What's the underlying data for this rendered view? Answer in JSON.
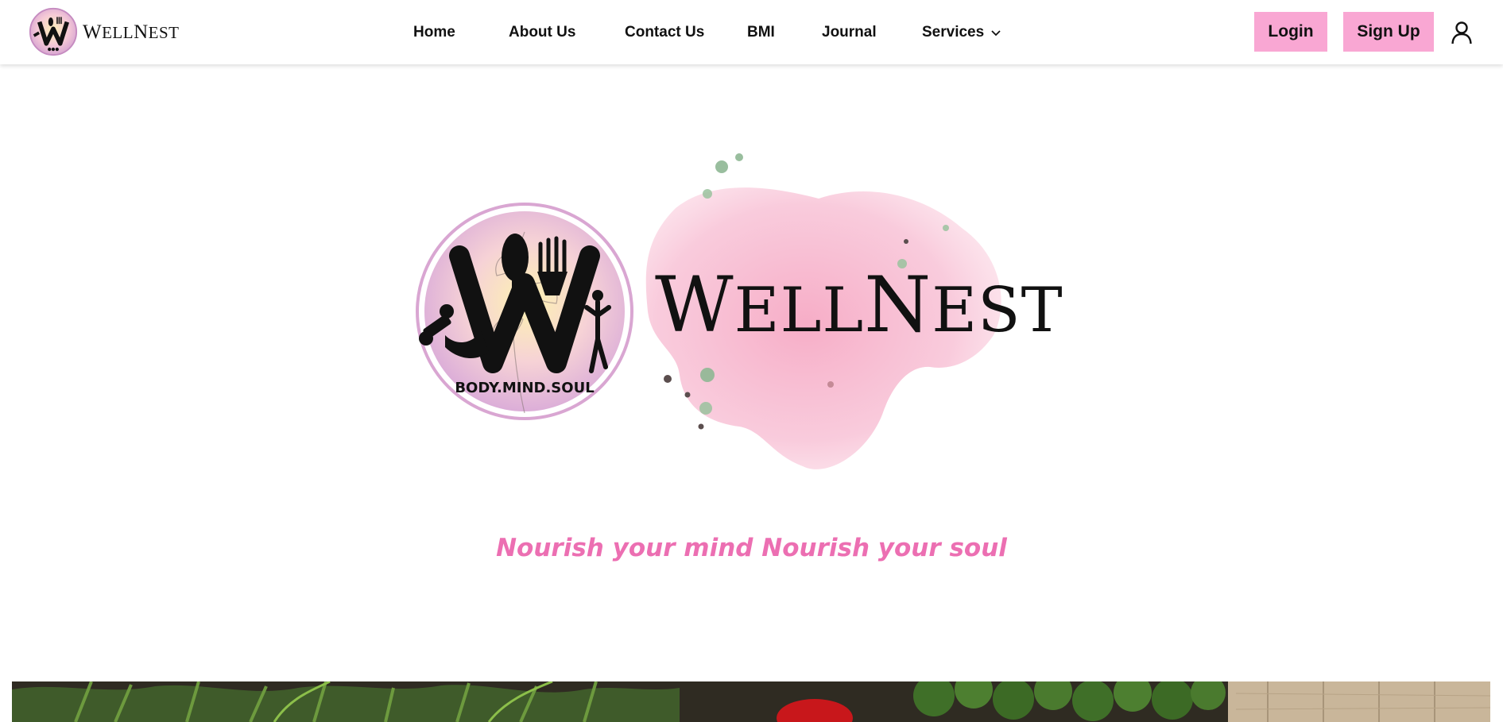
{
  "brand": {
    "name_first": "W",
    "name_rest_1": "ELL",
    "name_mid": "N",
    "name_rest_2": "EST",
    "emblem_text": "BODY.MIND.SOUL"
  },
  "nav": {
    "home": "Home",
    "about": "About Us",
    "contact": "Contact Us",
    "bmi": "BMI",
    "journal": "Journal",
    "services": "Services"
  },
  "auth": {
    "login": "Login",
    "signup": "Sign Up"
  },
  "hero": {
    "tagline": "Nourish your mind Nourish your soul"
  },
  "colors": {
    "accent_pink": "#f9a7d3",
    "tagline_pink": "#ec6fb2",
    "splash_pink": "#f7b9cf"
  },
  "icons": {
    "user": "user-icon",
    "services_chevron": "chevron-down-icon"
  }
}
